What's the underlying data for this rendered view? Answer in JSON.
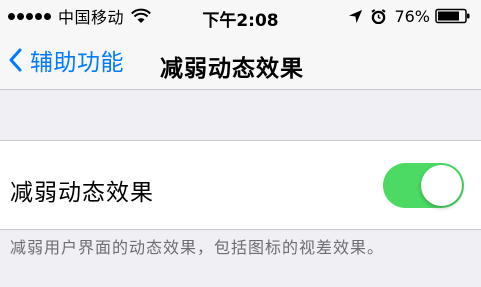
{
  "status_bar": {
    "carrier": "中国移动",
    "time": "下午2:08",
    "battery_percent": "76%",
    "icons": [
      "signal-dots-icon",
      "wifi-icon",
      "location-icon",
      "alarm-icon",
      "battery-icon"
    ]
  },
  "nav": {
    "back_label": "辅助功能",
    "title": "减弱动态效果",
    "accent_color": "#007aff"
  },
  "settings": {
    "reduce_motion": {
      "label": "减弱动态效果",
      "enabled": true,
      "on_color": "#4cd964"
    },
    "footer": "减弱用户界面的动态效果，包括图标的视差效果。"
  }
}
